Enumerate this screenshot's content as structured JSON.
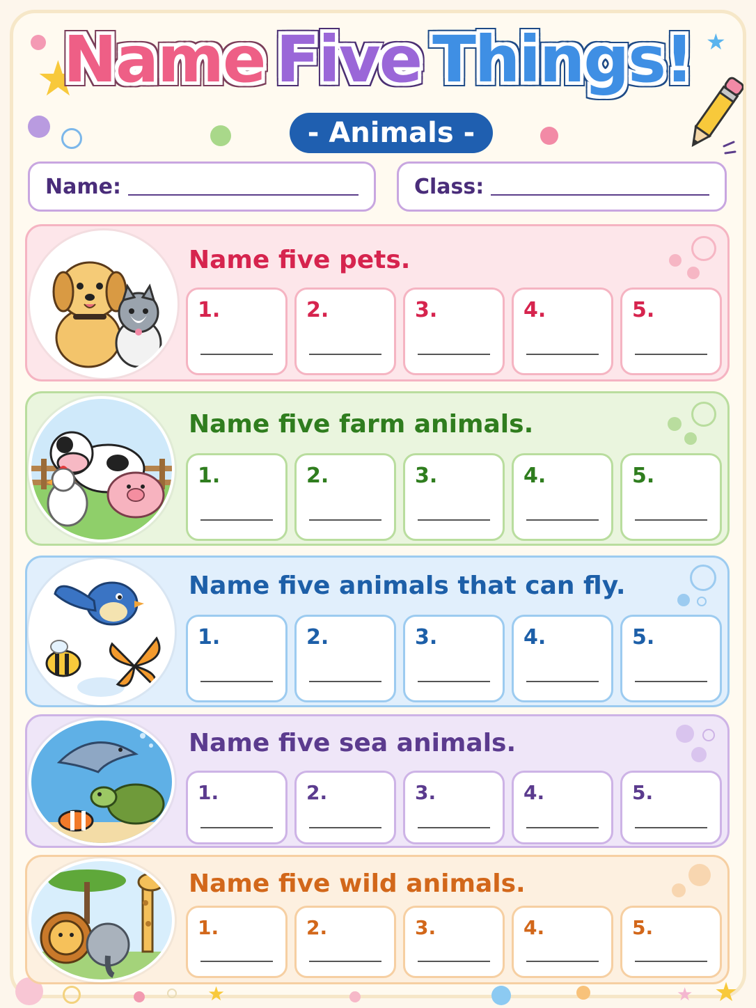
{
  "title": {
    "word1": "Name",
    "word2": "Five",
    "word3": "Things!"
  },
  "subtitle": "- Animals -",
  "fields": {
    "name_label": "Name:",
    "class_label": "Class:"
  },
  "sections": [
    {
      "prompt": "Name five pets.",
      "numbers": [
        "1.",
        "2.",
        "3.",
        "4.",
        "5."
      ],
      "color": "#d6244e",
      "border": "#f5b4c2",
      "bg": "#fde6ea",
      "image": "dog-and-cat-illustration"
    },
    {
      "prompt": "Name five farm animals.",
      "numbers": [
        "1.",
        "2.",
        "3.",
        "4.",
        "5."
      ],
      "color": "#2f7d1e",
      "border": "#b9dd9e",
      "bg": "#eaf5de",
      "image": "farm-animals-illustration"
    },
    {
      "prompt": "Name five animals that can fly.",
      "numbers": [
        "1.",
        "2.",
        "3.",
        "4.",
        "5."
      ],
      "color": "#1d5fa8",
      "border": "#9ccbf0",
      "bg": "#e1effc",
      "image": "bird-bee-butterfly-illustration"
    },
    {
      "prompt": "Name five sea animals.",
      "numbers": [
        "1.",
        "2.",
        "3.",
        "4.",
        "5."
      ],
      "color": "#5b3b8e",
      "border": "#cdb3e6",
      "bg": "#efe6f8",
      "image": "dolphin-turtle-fish-illustration"
    },
    {
      "prompt": "Name five wild animals.",
      "numbers": [
        "1.",
        "2.",
        "3.",
        "4.",
        "5."
      ],
      "color": "#d2671a",
      "border": "#f6cfa2",
      "bg": "#fdf0e0",
      "image": "lion-elephant-giraffe-illustration"
    }
  ]
}
